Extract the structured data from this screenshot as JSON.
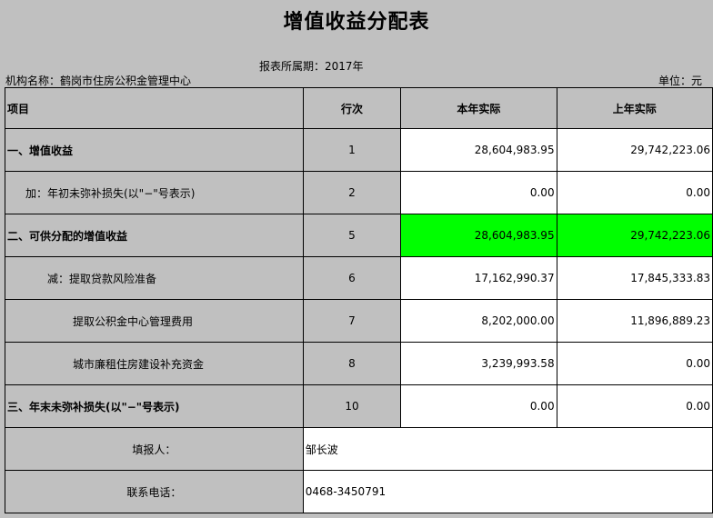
{
  "title": "增值收益分配表",
  "period": "报表所属期：2017年",
  "org": "机构名称：鹤岗市住房公积金管理中心",
  "unit": "单位：元",
  "headers": [
    "项目",
    "行次",
    "本年实际",
    "上年实际"
  ],
  "rows": [
    {
      "item": "一、增值收益",
      "line": "1",
      "current": "28,604,983.95",
      "previous": "29,742,223.06"
    },
    {
      "item": "加：年初未弥补损失(以\"−\"号表示)",
      "line": "2",
      "current": "0.00",
      "previous": "0.00"
    },
    {
      "item": "二、可供分配的增值收益",
      "line": "5",
      "current": "28,604,983.95",
      "previous": "29,742,223.06"
    },
    {
      "item": "减：提取贷款风险准备",
      "line": "6",
      "current": "17,162,990.37",
      "previous": "17,845,333.83"
    },
    {
      "item": "提取公积金中心管理费用",
      "line": "7",
      "current": "8,202,000.00",
      "previous": "11,896,889.23"
    },
    {
      "item": "城市廉租住房建设补充资金",
      "line": "8",
      "current": "3,239,993.58",
      "previous": "0.00"
    },
    {
      "item": "三、年末未弥补损失(以\"−\"号表示)",
      "line": "10",
      "current": "0.00",
      "previous": "0.00"
    }
  ],
  "footer": {
    "filler_label": "填报人：",
    "filler_value": "邹长波",
    "phone_label": "联系电话：",
    "phone_value": "0468-3450791"
  },
  "colors": {
    "highlight": "#00ff00",
    "background": "#c0c0c0"
  }
}
